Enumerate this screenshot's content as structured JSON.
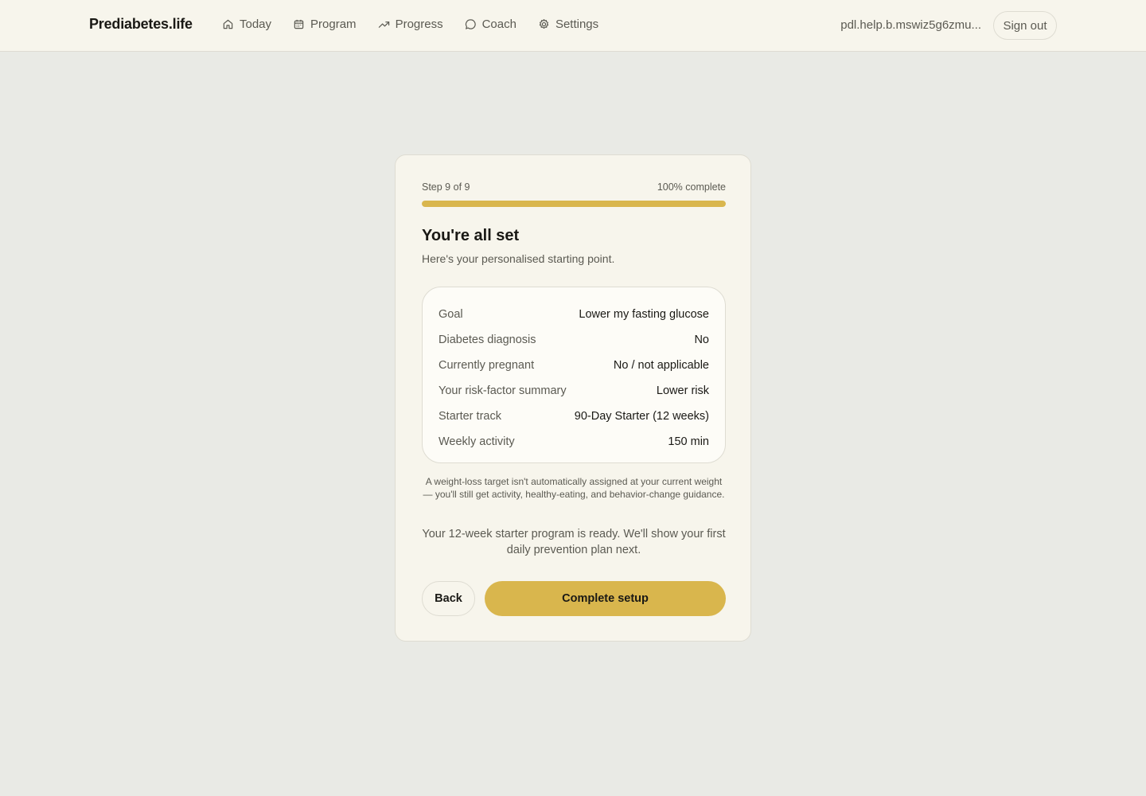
{
  "app": {
    "brand": "Prediabetes.life"
  },
  "nav": {
    "items": [
      {
        "label": "Today",
        "icon": "home-icon"
      },
      {
        "label": "Program",
        "icon": "calendar-icon"
      },
      {
        "label": "Progress",
        "icon": "trending-up-icon"
      },
      {
        "label": "Coach",
        "icon": "chat-bubble-icon"
      },
      {
        "label": "Settings",
        "icon": "gear-icon"
      }
    ]
  },
  "account": {
    "email": "pdl.help.b.mswiz5g6zmu...",
    "sign_out_label": "Sign out"
  },
  "onboarding": {
    "step_label": "Step 9 of 9",
    "complete_label": "100% complete",
    "progress_percent": 100,
    "title": "You're all set",
    "subtitle": "Here's your personalised starting point.",
    "summary": [
      {
        "label": "Goal",
        "value": "Lower my fasting glucose"
      },
      {
        "label": "Diabetes diagnosis",
        "value": "No"
      },
      {
        "label": "Currently pregnant",
        "value": "No / not applicable"
      },
      {
        "label": "Your risk-factor summary",
        "value": "Lower risk"
      },
      {
        "label": "Starter track",
        "value": "90-Day Starter (12 weeks)"
      },
      {
        "label": "Weekly activity",
        "value": "150 min"
      }
    ],
    "note": "A weight-loss target isn't automatically assigned at your current weight — you'll still get activity, healthy-eating, and behavior-change guidance.",
    "ready_message": "Your 12-week starter program is ready. We'll show your first daily prevention plan next.",
    "back_label": "Back",
    "complete_setup_label": "Complete setup"
  },
  "colors": {
    "accent": "#d9b64d",
    "background": "#e9eae5",
    "surface": "#f7f5ec"
  }
}
